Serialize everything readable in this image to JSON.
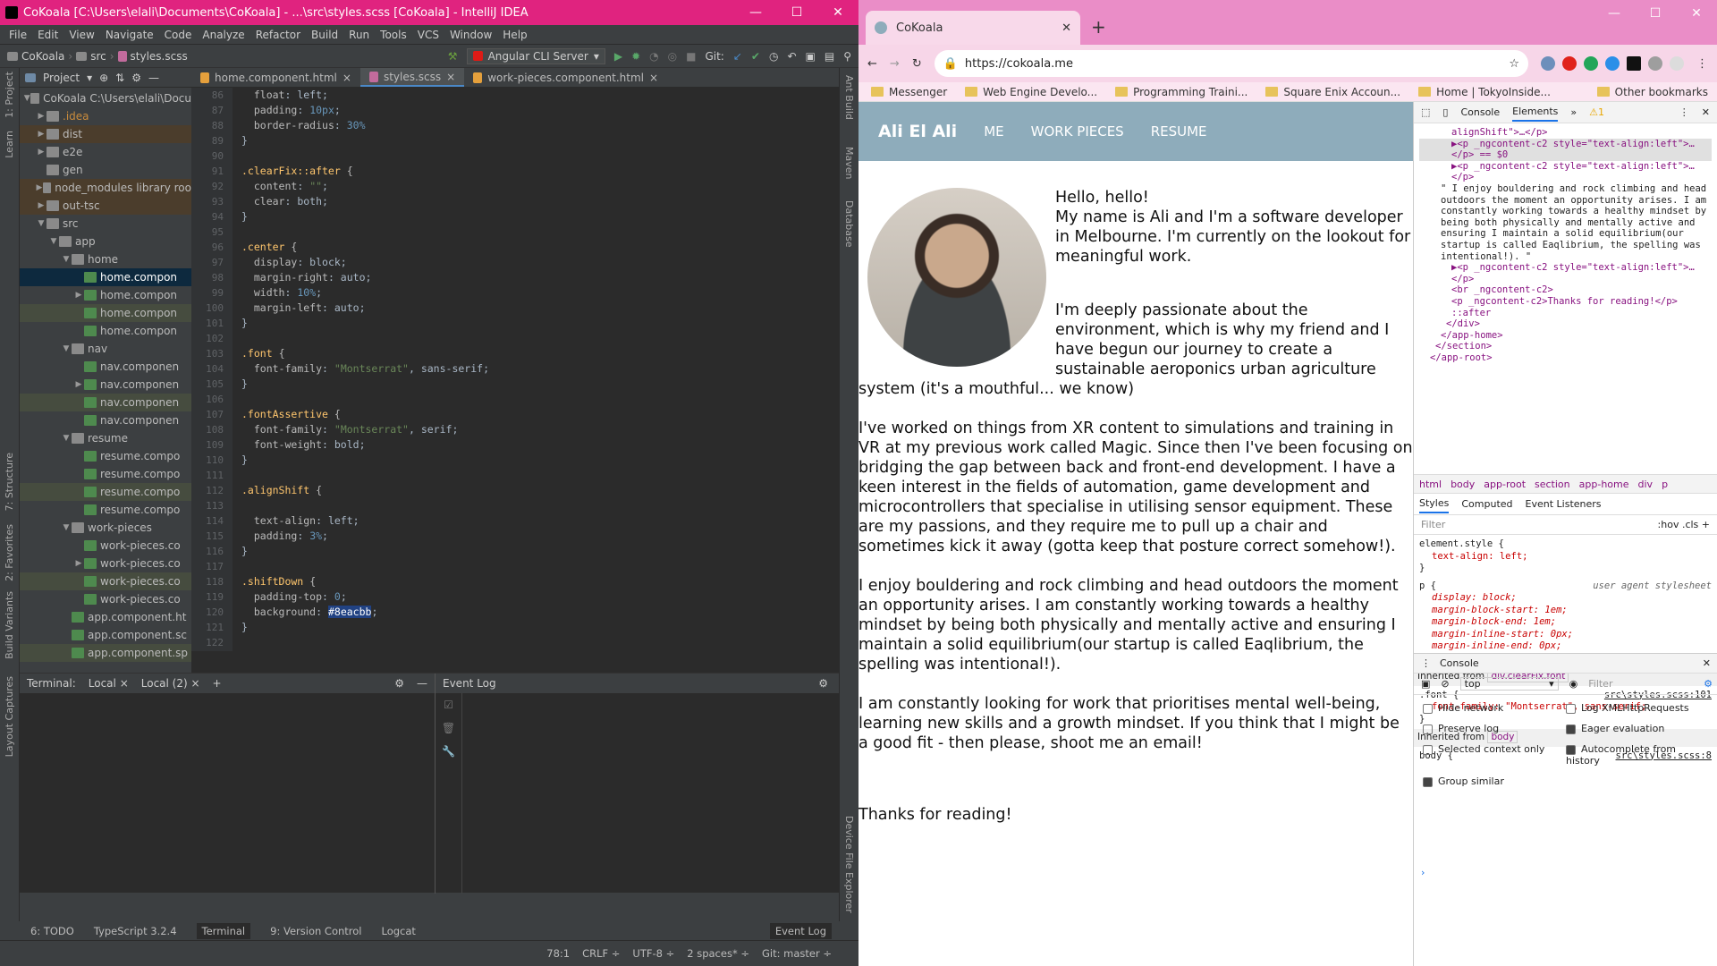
{
  "ide": {
    "title": "CoKoala [C:\\Users\\elali\\Documents\\CoKoala] - ...\\src\\styles.scss [CoKoala] - IntelliJ IDEA",
    "menu": [
      "File",
      "Edit",
      "View",
      "Navigate",
      "Code",
      "Analyze",
      "Refactor",
      "Build",
      "Run",
      "Tools",
      "VCS",
      "Window",
      "Help"
    ],
    "breadcrumb": [
      "CoKoala",
      "src",
      "styles.scss"
    ],
    "run_config": "Angular CLI Server",
    "git_label": "Git:",
    "project_tab": "Project",
    "tree": [
      {
        "label": "CoKoala  C:\\Users\\elali\\Docu",
        "depth": 0,
        "arrow": "▼",
        "kind": "folder"
      },
      {
        "label": ".idea",
        "depth": 1,
        "arrow": "▶",
        "kind": "folder",
        "style": "orange"
      },
      {
        "label": "dist",
        "depth": 1,
        "arrow": "▶",
        "kind": "folder",
        "style": "excl"
      },
      {
        "label": "e2e",
        "depth": 1,
        "arrow": "▶",
        "kind": "folder"
      },
      {
        "label": "gen",
        "depth": 1,
        "arrow": "",
        "kind": "folder"
      },
      {
        "label": "node_modules  library roo",
        "depth": 1,
        "arrow": "▶",
        "kind": "folder",
        "style": "excl"
      },
      {
        "label": "out-tsc",
        "depth": 1,
        "arrow": "▶",
        "kind": "folder",
        "style": "excl"
      },
      {
        "label": "src",
        "depth": 1,
        "arrow": "▼",
        "kind": "folder"
      },
      {
        "label": "app",
        "depth": 2,
        "arrow": "▼",
        "kind": "folder"
      },
      {
        "label": "home",
        "depth": 3,
        "arrow": "▼",
        "kind": "folder"
      },
      {
        "label": "home.compon",
        "depth": 4,
        "arrow": "",
        "kind": "file",
        "style": "sel"
      },
      {
        "label": "home.compon",
        "depth": 4,
        "arrow": "▶",
        "kind": "file"
      },
      {
        "label": "home.compon",
        "depth": 4,
        "arrow": "",
        "kind": "file",
        "style": "hl"
      },
      {
        "label": "home.compon",
        "depth": 4,
        "arrow": "",
        "kind": "file"
      },
      {
        "label": "nav",
        "depth": 3,
        "arrow": "▼",
        "kind": "folder"
      },
      {
        "label": "nav.componen",
        "depth": 4,
        "arrow": "",
        "kind": "file"
      },
      {
        "label": "nav.componen",
        "depth": 4,
        "arrow": "▶",
        "kind": "file"
      },
      {
        "label": "nav.componen",
        "depth": 4,
        "arrow": "",
        "kind": "file",
        "style": "hl"
      },
      {
        "label": "nav.componen",
        "depth": 4,
        "arrow": "",
        "kind": "file"
      },
      {
        "label": "resume",
        "depth": 3,
        "arrow": "▼",
        "kind": "folder"
      },
      {
        "label": "resume.compo",
        "depth": 4,
        "arrow": "",
        "kind": "file"
      },
      {
        "label": "resume.compo",
        "depth": 4,
        "arrow": "",
        "kind": "file"
      },
      {
        "label": "resume.compo",
        "depth": 4,
        "arrow": "",
        "kind": "file",
        "style": "hl"
      },
      {
        "label": "resume.compo",
        "depth": 4,
        "arrow": "",
        "kind": "file"
      },
      {
        "label": "work-pieces",
        "depth": 3,
        "arrow": "▼",
        "kind": "folder"
      },
      {
        "label": "work-pieces.co",
        "depth": 4,
        "arrow": "",
        "kind": "file"
      },
      {
        "label": "work-pieces.co",
        "depth": 4,
        "arrow": "▶",
        "kind": "file"
      },
      {
        "label": "work-pieces.co",
        "depth": 4,
        "arrow": "",
        "kind": "file",
        "style": "hl"
      },
      {
        "label": "work-pieces.co",
        "depth": 4,
        "arrow": "",
        "kind": "file"
      },
      {
        "label": "app.component.ht",
        "depth": 3,
        "arrow": "",
        "kind": "file"
      },
      {
        "label": "app.component.sc",
        "depth": 3,
        "arrow": "",
        "kind": "file"
      },
      {
        "label": "app.component.sp",
        "depth": 3,
        "arrow": "",
        "kind": "file",
        "style": "hl"
      }
    ],
    "tabs": [
      {
        "label": "home.component.html",
        "active": false
      },
      {
        "label": "styles.scss",
        "active": true
      },
      {
        "label": "work-pieces.component.html",
        "active": false
      }
    ],
    "code_start": 86,
    "code": [
      "  float: left;",
      "  padding: 10px;",
      "  border-radius: 30%",
      "}",
      "",
      ".clearFix::after {",
      "  content: \"\";",
      "  clear: both;",
      "}",
      "",
      ".center {",
      "  display: block;",
      "  margin-right: auto;",
      "  width: 10%;",
      "  margin-left: auto;",
      "}",
      "",
      ".font {",
      "  font-family: \"Montserrat\", sans-serif;",
      "}",
      "",
      ".fontAssertive {",
      "  font-family: \"Montserrat\", serif;",
      "  font-weight: bold;",
      "}",
      "",
      ".alignShift {",
      "",
      "  text-align: left;",
      "  padding: 3%;",
      "}",
      "",
      ".shiftDown {",
      "  padding-top: 0;",
      "  background: #8eacbb;",
      "}",
      ""
    ],
    "bottom_tabs": [
      "Terminal:",
      "Local",
      "Local (2)"
    ],
    "event_log_title": "Event Log",
    "tool_tabs": [
      "6: TODO",
      "TypeScript 3.2.4",
      "Terminal",
      "9: Version Control",
      "Logcat"
    ],
    "event_log_btn": "Event Log",
    "status": [
      "78:1",
      "CRLF ÷",
      "UTF-8 ÷",
      "2 spaces* ÷",
      "Git: master ÷"
    ],
    "left_strip": [
      "1: Project",
      "Learn",
      "7: Structure",
      "2: Favorites",
      "Build Variants",
      "Layout Captures"
    ],
    "right_strip": [
      "Ant Build",
      "Maven",
      "Database",
      "Device File Explorer"
    ]
  },
  "browser": {
    "tab_title": "CoKoala",
    "url": "https://cokoala.me",
    "bookmarks": [
      "Messenger",
      "Web Engine Develo...",
      "Programming Traini...",
      "Square Enix Accoun...",
      "Home | TokyoInside..."
    ],
    "other_bookmarks": "Other bookmarks",
    "accent": "#8eacbb",
    "site": {
      "brand": "Ali El Ali",
      "nav": [
        "ME",
        "WORK PIECES",
        "RESUME"
      ],
      "intro": "Hello, hello!\nMy name is Ali and I'm a software developer in Melbourne. I'm currently on the lookout for meaningful work.",
      "paragraphs": [
        "I'm deeply passionate about the environment, which is why my friend and I have begun our journey to create a sustainable aeroponics urban agriculture system (it's a mouthful... we know)",
        "I've worked on things from XR content to simulations and training in VR at my previous work called Magic. Since then I've been focusing on bridging the gap between back and front-end development. I have a keen interest in the fields of automation, game development and microcontrollers that specialise in utilising sensor equipment. These are my passions, and they require me to pull up a chair and sometimes kick it away (gotta keep that posture correct somehow!).",
        "I enjoy bouldering and rock climbing and head outdoors the moment an opportunity arises. I am constantly working towards a healthy mindset by being both physically and mentally active and ensuring I maintain a solid equilibrium(our startup is called Eaqlibrium, the spelling was intentional!).",
        "I am constantly looking for work that prioritises mental well-being, learning new skills and a growth mindset. If you think that I might be a good fit - then please, shoot me an email!"
      ],
      "thanks": "Thanks for reading!"
    },
    "devtools": {
      "tabs": [
        "Console",
        "Elements"
      ],
      "warnings": "1",
      "dom": [
        "alignShift\">…</p>",
        "▶<p _ngcontent-c2 style=\"text-align:left\">…</p> == $0",
        "▶<p _ngcontent-c2 style=\"text-align:left\">…</p>",
        "\" I enjoy bouldering and rock climbing and head outdoors the moment an opportunity arises. I am constantly working towards a healthy mindset by being both physically and mentally active and ensuring I maintain a solid equilibrium(our startup is called Eaqlibrium, the spelling was intentional!). \"",
        "▶<p _ngcontent-c2 style=\"text-align:left\">…</p>",
        "<br _ngcontent-c2>",
        "<p _ngcontent-c2>Thanks for reading!</p>",
        "::after",
        "</div>",
        "</app-home>",
        "</section>",
        "</app-root>"
      ],
      "crumbs": [
        "html",
        "body",
        "app-root",
        "section",
        "app-home",
        "div",
        "p"
      ],
      "style_tabs": [
        "Styles",
        "Computed",
        "Event Listeners"
      ],
      "filter_placeholder": "Filter",
      "filter_right": ":hov  .cls  +",
      "styles": {
        "element_style": "element.style {",
        "element_prop": "text-align: left;",
        "ua_selector": "p {",
        "ua_label": "user agent stylesheet",
        "ua_props": [
          "display: block;",
          "margin-block-start: 1em;",
          "margin-block-end: 1em;",
          "margin-inline-start: 0px;",
          "margin-inline-end: 0px;"
        ],
        "inherited1": "Inherited from",
        "inherited1_chip": "div.clearFix.font",
        "font_selector": ".font {",
        "font_src": "src\\styles.scss:101",
        "font_prop": "font-family: \"Montserrat\", sans-serif;",
        "inherited2_chip": "body",
        "body_selector": "body {",
        "body_src": "src\\styles.scss:8"
      },
      "console_title": "Console",
      "context": "top",
      "console_filter": "Filter",
      "options": [
        {
          "label": "Hide network",
          "on": false
        },
        {
          "label": "Log XMLHttpRequests",
          "on": false
        },
        {
          "label": "Preserve log",
          "on": false
        },
        {
          "label": "Eager evaluation",
          "on": true
        },
        {
          "label": "Selected context only",
          "on": false
        },
        {
          "label": "Autocomplete from history",
          "on": true
        },
        {
          "label": "Group similar",
          "on": true
        }
      ]
    }
  }
}
